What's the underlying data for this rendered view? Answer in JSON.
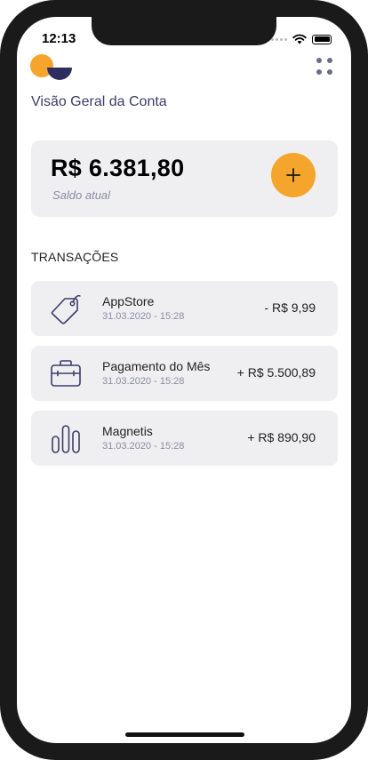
{
  "status_bar": {
    "time": "12:13"
  },
  "header": {
    "title": "Visão Geral da Conta"
  },
  "balance": {
    "amount": "R$ 6.381,80",
    "label": "Saldo atual",
    "add_label": "+"
  },
  "transactions_section": {
    "title": "TRANSAÇÕES"
  },
  "transactions": [
    {
      "icon": "tag-icon",
      "name": "AppStore",
      "date": "31.03.2020 - 15:28",
      "amount": "- R$ 9,99"
    },
    {
      "icon": "briefcase-icon",
      "name": "Pagamento do Mês",
      "date": "31.03.2020 - 15:28",
      "amount": "+ R$ 5.500,89"
    },
    {
      "icon": "bar-chart-icon",
      "name": "Magnetis",
      "date": "31.03.2020 - 15:28",
      "amount": "+ R$ 890,90"
    }
  ],
  "colors": {
    "accent": "#f5a42c",
    "brand_navy": "#3a3d6a",
    "card_bg": "#efeff2"
  }
}
